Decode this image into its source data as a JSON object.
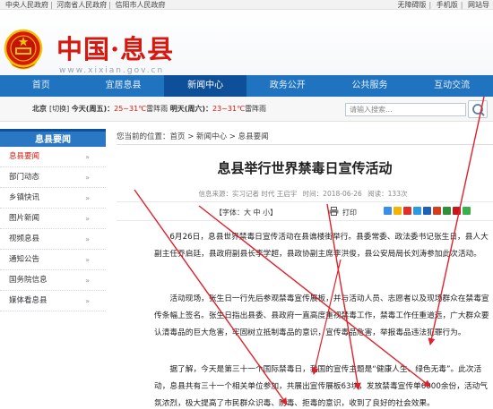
{
  "topbar": {
    "links": [
      "中央人民政府",
      "河南省人民政府",
      "信阳市人民政府"
    ],
    "sep": "|",
    "right_links": [
      "无障碍版",
      "手机版",
      "网站导"
    ]
  },
  "banner": {
    "title": "中国·息县",
    "url": "www.xixian.gov.cn"
  },
  "nav": {
    "items": [
      "首页",
      "宜居息县",
      "新闻中心",
      "政务公开",
      "公共服务",
      "互动交流"
    ],
    "active_index": 2
  },
  "weather": {
    "city": "北京",
    "city_action": "[切换]",
    "today_label": "今天(周五)：",
    "today_temp": "25~31℃",
    "today_desc": "雷阵雨",
    "tomorrow_label": "明天(周六)：",
    "tomorrow_temp": "23~31℃",
    "tomorrow_desc": "雷阵雨"
  },
  "search": {
    "placeholder": "请输入搜索..."
  },
  "sidebar": {
    "heading": "息县要闻",
    "items": [
      {
        "label": "息县要闻",
        "active": true
      },
      {
        "label": "部门动态"
      },
      {
        "label": "乡镇快讯"
      },
      {
        "label": "图片新闻"
      },
      {
        "label": "视频息县"
      },
      {
        "label": "通知公告"
      },
      {
        "label": "国务院信息"
      },
      {
        "label": "媒体看息县"
      }
    ],
    "arrow": "»"
  },
  "breadcrumb": {
    "prefix": "您当前的位置：",
    "path": "首页 > 新闻中心 > 息县要闻"
  },
  "article": {
    "title": "息县举行世界禁毒日宣传活动",
    "source": "信息来源：实习记者 时代 王启宇",
    "date": "时间：2018-06-26",
    "views": "阅读：133次",
    "font_label": "【字体：",
    "font_sizes": [
      "大",
      "中",
      "小"
    ],
    "font_close": "】",
    "print_label": "打印",
    "paragraphs": [
      "6月26日，息县世界禁毒日宣传活动在县谯楼街举行。县委常委、政法委书记张生日，县人大副主任乔启廷，县政府副县长李学超，县政协副主席李洪俊，县公安局局长刘涛参加此次活动。",
      "活动现场，张生日一行先后参观禁毒宣传展板，并与活动人员、志愿者以及现场群众在禁毒宣传条幅上签名。张生日指出县委、县政府一直高度重视禁毒工作，禁毒工作任重道远，广大群众要认清毒品的巨大危害，牢固树立抵制毒品的意识，宣传毒品危害，举报毒品违法犯罪行为。",
      "据了解，今天是第三十一个国际禁毒日，我国的宣传主题是“健康人生、绿色无毒”。此次活动，息县共有三十一个相关单位参加，共展出宣传展板63块，发放禁毒宣传单6000余份，活动气氛浓烈，极大提高了市民群众识毒、防毒、拒毒的意识，收到了良好的社会效果。"
    ]
  },
  "colors": {
    "brand_red": "#d5190f",
    "nav_blue": "#1f73bf",
    "nav_active": "#0e4f9a",
    "arrow_red": "#e0202a"
  }
}
